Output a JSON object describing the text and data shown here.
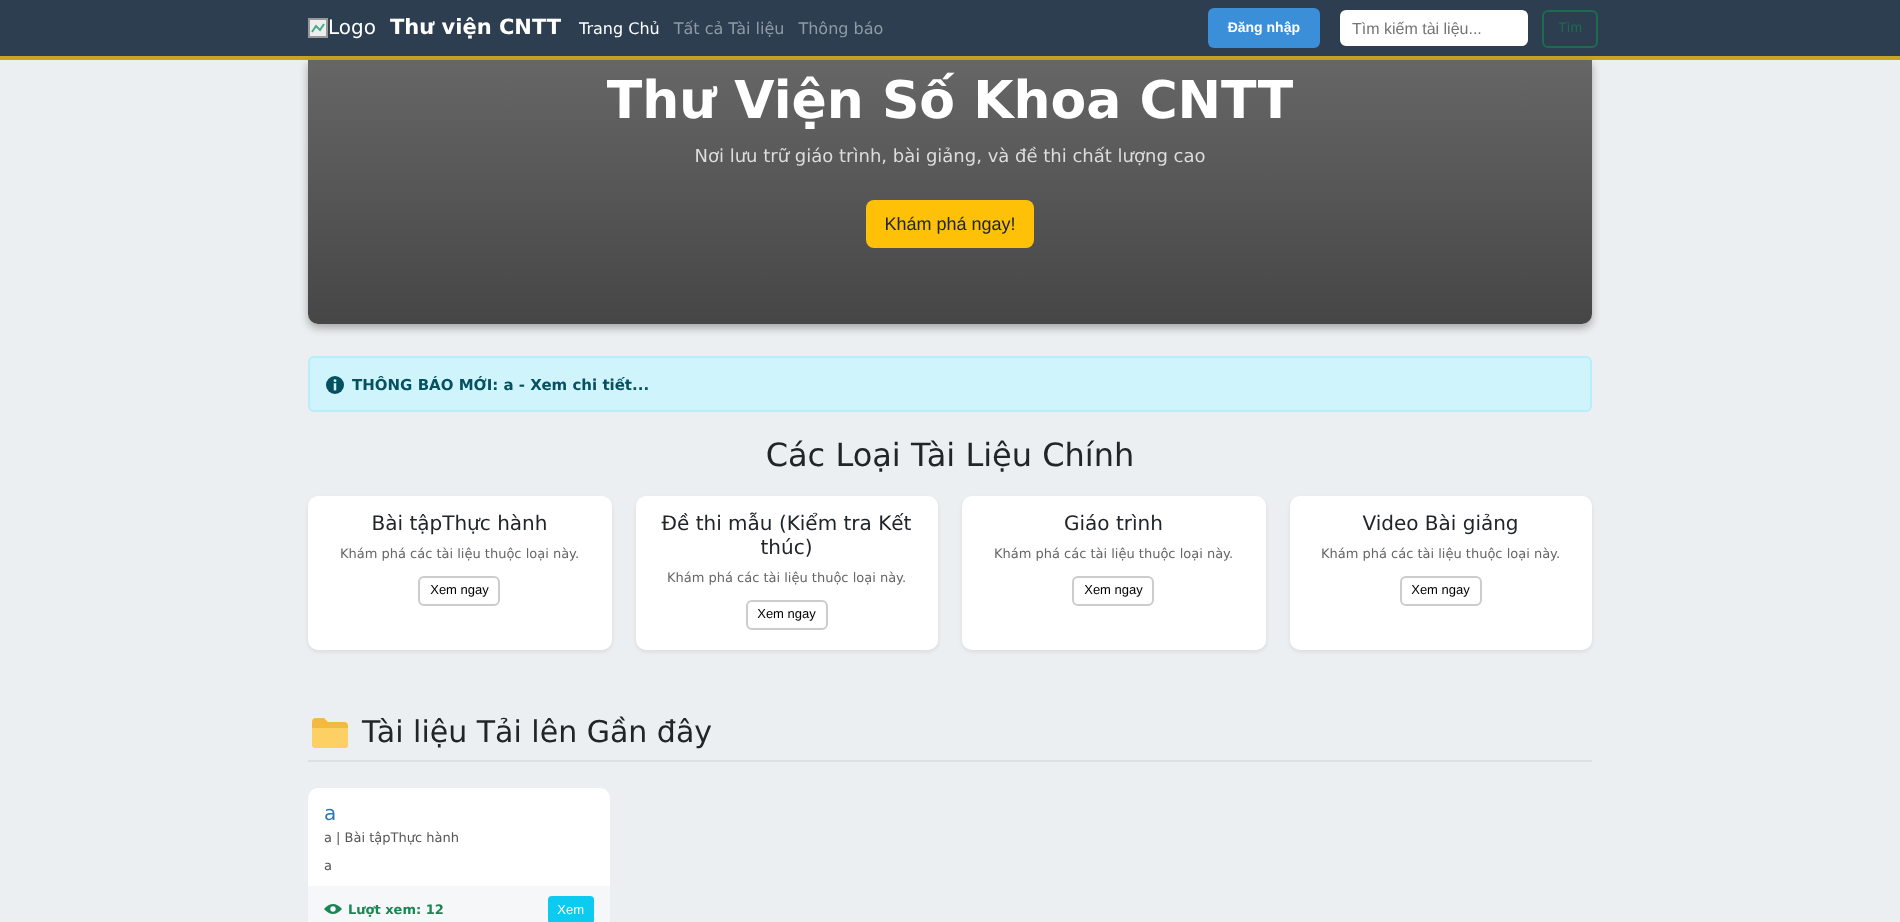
{
  "navbar": {
    "logo_alt": "Logo",
    "brand": "Thư viện CNTT",
    "links": [
      {
        "label": "Trang Chủ",
        "selected": true
      },
      {
        "label": "Tất cả Tài liệu",
        "selected": false
      },
      {
        "label": "Thông báo",
        "selected": false
      }
    ],
    "login_button": "Đăng nhập",
    "search": {
      "placeholder": "Tìm kiếm tài liệu..."
    },
    "search_button": "Tìm"
  },
  "hero": {
    "title": "Thư Viện Số Khoa CNTT",
    "subtitle": "Nơi lưu trữ giáo trình, bài giảng, và đề thi chất lượng cao",
    "button": "Khám phá ngay!"
  },
  "alert": {
    "text": "THÔNG BÁO MỚI: a - Xem chi tiết..."
  },
  "categories": {
    "title": "Các Loại Tài Liệu Chính",
    "items": [
      {
        "name": "Bài tậpThực hành",
        "description": "Khám phá các tài liệu thuộc loại này.",
        "button": "Xem ngay"
      },
      {
        "name": "Đề thi mẫu (Kiểm tra Kết thúc)",
        "description": "Khám phá các tài liệu thuộc loại này.",
        "button": "Xem ngay"
      },
      {
        "name": "Giáo trình",
        "description": "Khám phá các tài liệu thuộc loại này.",
        "button": "Xem ngay"
      },
      {
        "name": "Video Bài giảng",
        "description": "Khám phá các tài liệu thuộc loại này.",
        "button": "Xem ngay"
      }
    ]
  },
  "recent": {
    "title": "Tài liệu Tải lên Gần đây",
    "documents": [
      {
        "title": "a",
        "meta": "a | Bài tậpThực hành",
        "description": "a",
        "views": "Lượt xem: 12",
        "button": "Xem"
      }
    ]
  }
}
